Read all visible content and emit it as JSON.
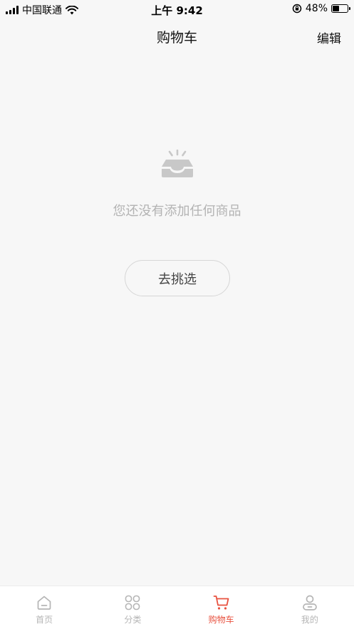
{
  "status_bar": {
    "carrier": "中国联通",
    "time": "上午 9:42",
    "battery_percent": "48%",
    "battery_level": 0.48
  },
  "header": {
    "title": "购物车",
    "edit_label": "编辑"
  },
  "empty_state": {
    "icon": "inbox-icon",
    "message": "您还没有添加任何商品",
    "button_label": "去挑选"
  },
  "tab_bar": {
    "active_color": "#e8513f",
    "inactive_color": "#b5b5b5",
    "items": [
      {
        "label": "首页",
        "icon": "home-icon",
        "active": false
      },
      {
        "label": "分类",
        "icon": "category-grid-icon",
        "active": false
      },
      {
        "label": "购物车",
        "icon": "cart-icon",
        "active": true
      },
      {
        "label": "我的",
        "icon": "user-icon",
        "active": false
      }
    ]
  }
}
